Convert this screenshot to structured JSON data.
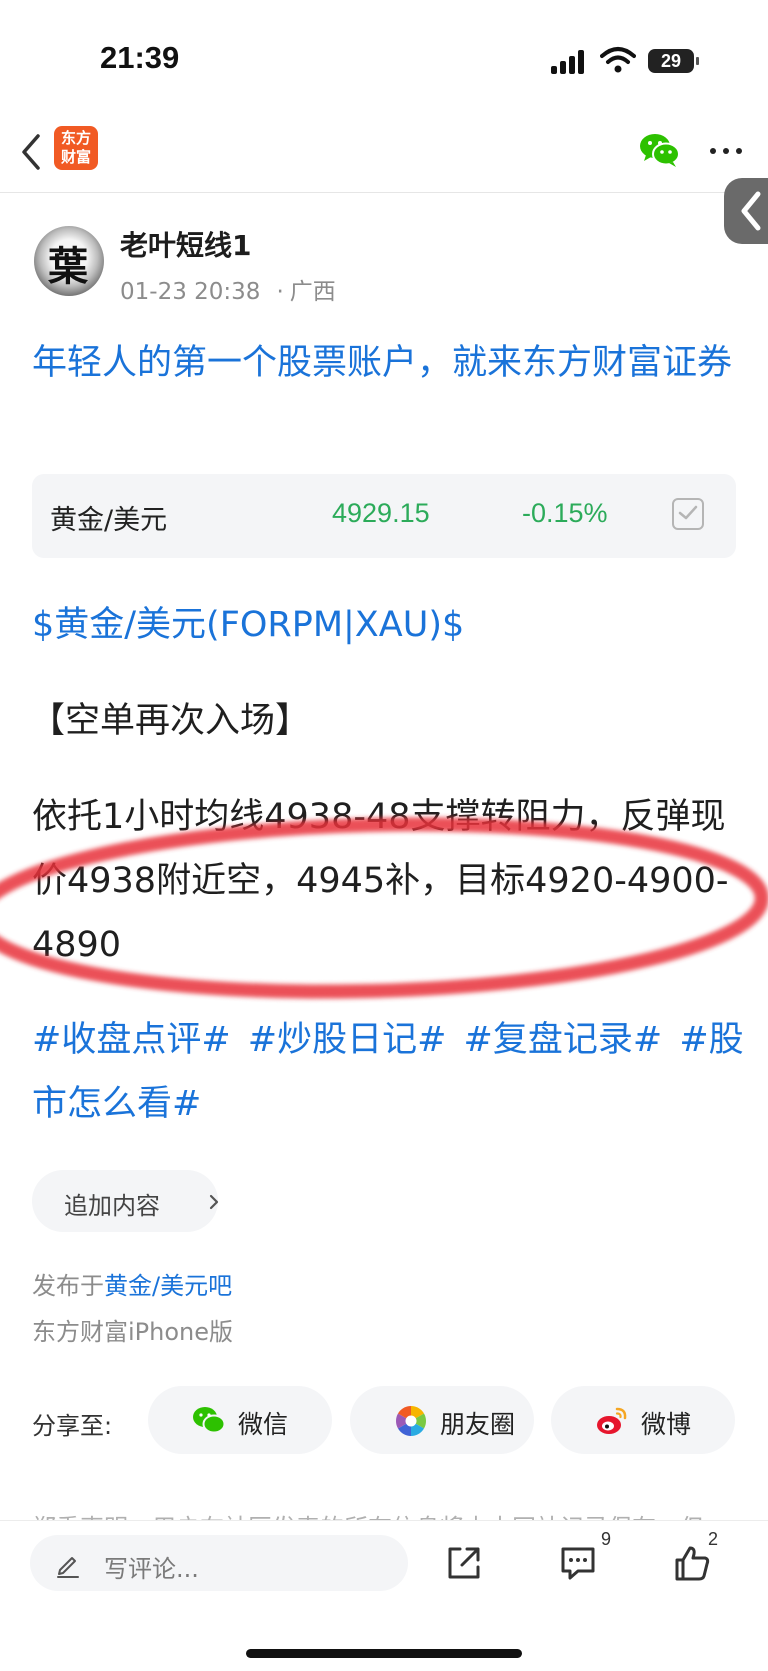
{
  "status_bar": {
    "time": "21:39",
    "battery": "29"
  },
  "nav": {
    "logo_line1": "东方",
    "logo_line2": "财富"
  },
  "author": {
    "name": "老叶短线1",
    "timestamp": "01-23 20:38",
    "dot": "·",
    "location": "广西",
    "avatar_glyph": "葉"
  },
  "ad_title": "年轻人的第一个股票账户，就来东方财富证券",
  "quote": {
    "name": "黄金/美元",
    "price": "4929.15",
    "change": "-0.15%",
    "color": "#2cab5a"
  },
  "stock_link": "$黄金/美元(FORPM|XAU)$",
  "post": {
    "heading": "【空单再次入场】",
    "body": "依托1小时均线4938-48支撑转阻力，反弹现价4938附近空，4945补，目标4920-4900-4890",
    "tags": "#收盘点评# #炒股日记# #复盘记录# #股市怎么看#"
  },
  "add_content": "追加内容",
  "published": {
    "prefix": "发布于",
    "forum": "黄金/美元吧",
    "device": "东方财富iPhone版"
  },
  "share": {
    "label": "分享至:",
    "wechat": "微信",
    "moments": "朋友圈",
    "weibo": "微博"
  },
  "disclaimer": "郑重声明：用户在社区发表的所有信息将由本网站记录保存，但",
  "bottom": {
    "comment_placeholder": "写评论...",
    "comment_count": "9",
    "like_count": "2"
  },
  "colors": {
    "link_blue": "#1a73d9",
    "price_green": "#2cab5a",
    "brand_orange": "#f15a24",
    "annotation_red": "#e8333a"
  }
}
